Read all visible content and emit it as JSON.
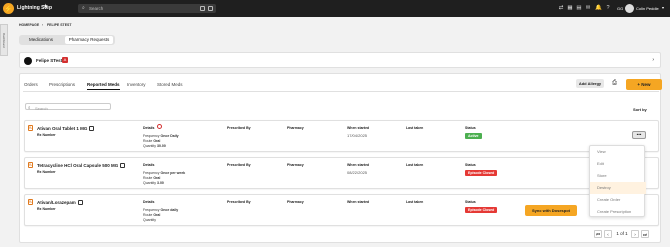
{
  "app": {
    "brand": "Lightning Step",
    "search_placeholder": "Search",
    "user_initials": "GG",
    "user_name": "Colin Peddle"
  },
  "breadcrumb": [
    "HOMEPAGE",
    "FELIPE STEST"
  ],
  "side_tab": "Dashboard",
  "main_tabs": [
    "Medications",
    "Pharmacy Requests"
  ],
  "patient": {
    "name": "Felipe STest",
    "badge": "A"
  },
  "sub_tabs": [
    "Orders",
    "Prescriptions",
    "Reported Meds",
    "Inventory",
    "Stored Meds"
  ],
  "actions": {
    "add_allergy": "Add Allergy",
    "new": "+ New",
    "sort_by": "Sort by",
    "search_placeholder": "Search"
  },
  "columns": {
    "details": "Details",
    "prescribed_by": "Prescribed By",
    "pharmacy": "Pharmacy",
    "when_started": "When started",
    "last_taken": "Last taken",
    "status": "Status"
  },
  "meds": [
    {
      "name": "Ativan Oral Tablet 1 MG",
      "rx": "Rx Number",
      "frequency": "Once Daily",
      "route": "Oral",
      "quantity": "30.00",
      "started": "17/04/2025",
      "status": "Active",
      "status_color": "#4caf50"
    },
    {
      "name": "Tetracycline HCl Oral Capsule 500 MG",
      "rx": "Rx Number",
      "frequency": "Once per week",
      "route": "Oral",
      "quantity": "3.00",
      "started": "08/22/2025",
      "status": "Episode Closed",
      "status_color": "#e53935"
    },
    {
      "name": "Ativan/Lorazepam",
      "rx": "Rx Number",
      "frequency": "Once daily",
      "route": "Oral",
      "quantity": "",
      "started": "",
      "status": "Episode Closed",
      "status_color": "#e53935",
      "sync_label": "Sync with Dosespot"
    }
  ],
  "labels": {
    "frequency": "Frequency",
    "route": "Route",
    "quantity": "Quantity"
  },
  "more_label": "•••",
  "menu": [
    "View",
    "Edit",
    "Store",
    "Destroy",
    "Create Order",
    "Create Prescription"
  ],
  "pager": {
    "info": "1 of 1"
  },
  "colors": {
    "accent": "#f5a623",
    "topbar": "#1f1f1f"
  }
}
